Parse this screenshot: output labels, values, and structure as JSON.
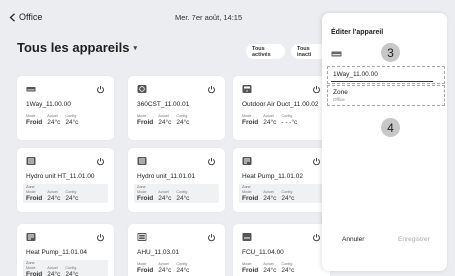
{
  "header": {
    "back_label": "Office",
    "datetime": "Mer. 7er août, 14:15"
  },
  "page": {
    "title": "Tous les appareils"
  },
  "filters": [
    "Tous activés",
    "Tous inacti"
  ],
  "cards": [
    {
      "name": "1Way_11.00.00",
      "icon": "ceiling-unit-icon",
      "zone": "",
      "mode_label": "Mode",
      "mode": "Froid",
      "actual_label": "Actuel",
      "actual": "24°c",
      "config_label": "Config",
      "config": "24°c"
    },
    {
      "name": "360CST_11.00.01",
      "icon": "round-cassette-icon",
      "zone": "",
      "mode_label": "Mode",
      "mode": "Froid",
      "actual_label": "Actuel",
      "actual": "24°c",
      "config_label": "Config",
      "config": "24°c"
    },
    {
      "name": "Outdoor Air Duct_11.00.02",
      "icon": "air-duct-icon",
      "zone": "",
      "mode_label": "Mode",
      "mode": "Froid",
      "actual_label": "Actuel",
      "actual": "24°c",
      "config_label": "Config",
      "config": "- - -°c"
    },
    {
      "name": "Hydro unit HT_11.01.00",
      "icon": "hydro-unit-icon",
      "zone": "Zone",
      "mode_label": "Mode",
      "mode": "Froid",
      "actual_label": "Actuel",
      "actual": "24°c",
      "config_label": "Config",
      "config": "24°c"
    },
    {
      "name": "Hydro unit_11.01.01",
      "icon": "hydro-unit-icon",
      "zone": "Zone",
      "mode_label": "Mode",
      "mode": "Froid",
      "actual_label": "Actuel",
      "actual": "24°c",
      "config_label": "Config",
      "config": "24°c"
    },
    {
      "name": "Heat Pump_11.01.02",
      "icon": "heat-pump-icon",
      "zone": "Zone",
      "mode_label": "Mode",
      "mode": "Froid",
      "actual_label": "Actuel",
      "actual": "24°c",
      "config_label": "Config",
      "config": "24°c"
    },
    {
      "name": "Heat Pump_11.01.04",
      "icon": "heat-pump-icon",
      "zone": "Zone",
      "mode_label": "Mode",
      "mode": "Froid",
      "actual_label": "Actuel",
      "actual": "24°c",
      "config_label": "Config",
      "config": "24°c"
    },
    {
      "name": "AHU_11.03.01",
      "icon": "ahu-icon",
      "zone": "",
      "mode_label": "Mode",
      "mode": "Froid",
      "actual_label": "Actuel",
      "actual": "24°c",
      "config_label": "Config",
      "config": "24°c"
    },
    {
      "name": "FCU_11.04.00",
      "icon": "fcu-icon",
      "zone": "",
      "mode_label": "Mode",
      "mode": "Froid",
      "actual_label": "Actuel",
      "actual": "24°c",
      "config_label": "Config",
      "config": "24°c"
    }
  ],
  "edit_panel": {
    "title": "Éditer l'appareil",
    "partial_value": "00",
    "device_name_value": "1Way_11.00.00",
    "zone_label": "Zone",
    "zone_value": "Office",
    "marker_3": "3",
    "marker_4": "4",
    "cancel_label": "Annuler",
    "save_label": "Enregistrer"
  },
  "colors": {
    "background": "#ecedf0",
    "card": "#ffffff",
    "marker": "#c7c7c7",
    "disabled_text": "#aaaaaa"
  }
}
